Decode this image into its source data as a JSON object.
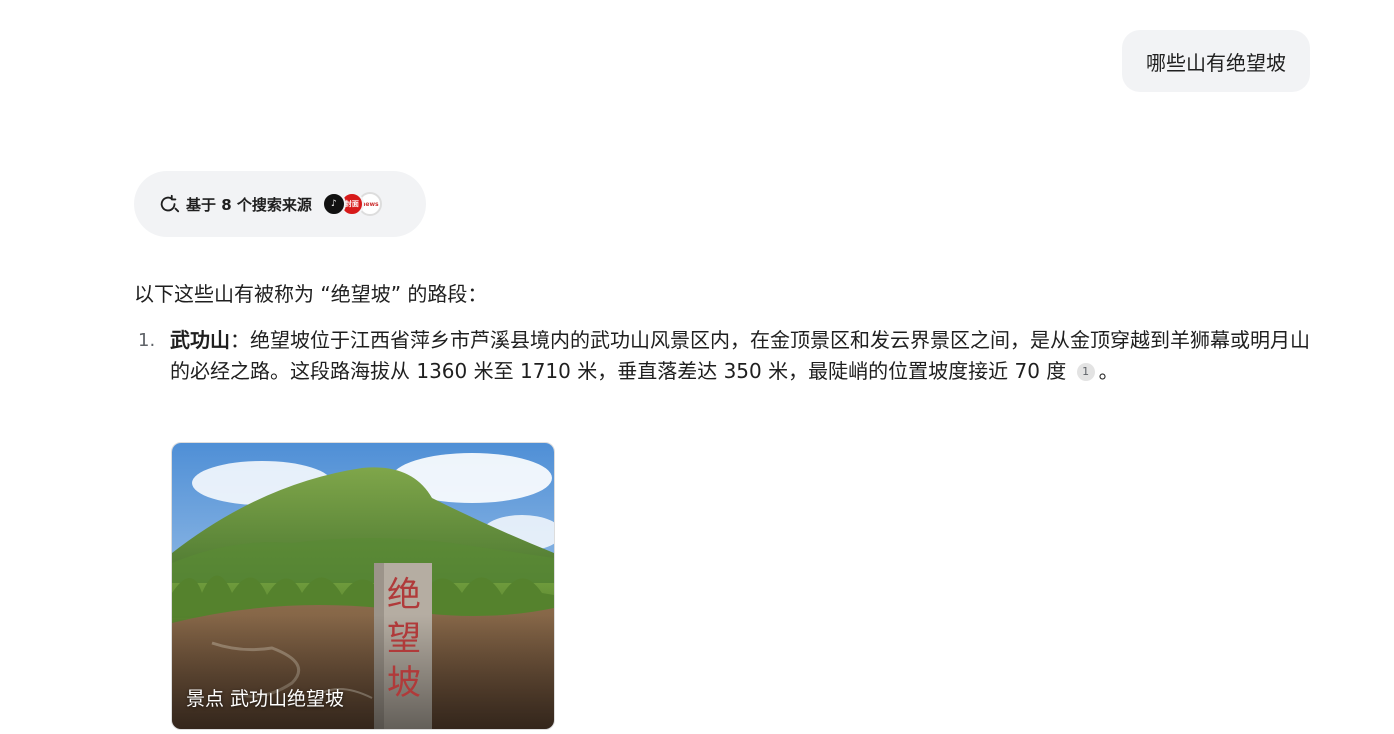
{
  "user_message": "哪些山有绝望坡",
  "sources": {
    "label": "基于 8 个搜索来源",
    "icons": [
      "tiktok-icon",
      "news-icon",
      "news-icon-2"
    ],
    "icon_text": [
      "♪",
      "封面",
      "news"
    ]
  },
  "answer": {
    "intro": "以下这些山有被称为 “绝望坡” 的路段：",
    "items": [
      {
        "number": "1.",
        "title": "武功山",
        "text": "：绝望坡位于江西省萍乡市芦溪县境内的武功山风景区内，在金顶景区和发云界景区之间，是从金顶穿越到羊狮幕或明月山的必经之路。这段路海拔从 1360 米至 1710 米，垂直落差达 350 米，最陡峭的位置坡度接近 70 度",
        "citation": "1",
        "end": "。"
      }
    ]
  },
  "image_card": {
    "caption": "景点 武功山绝望坡",
    "stone_text": [
      "绝",
      "望",
      "坡"
    ]
  }
}
